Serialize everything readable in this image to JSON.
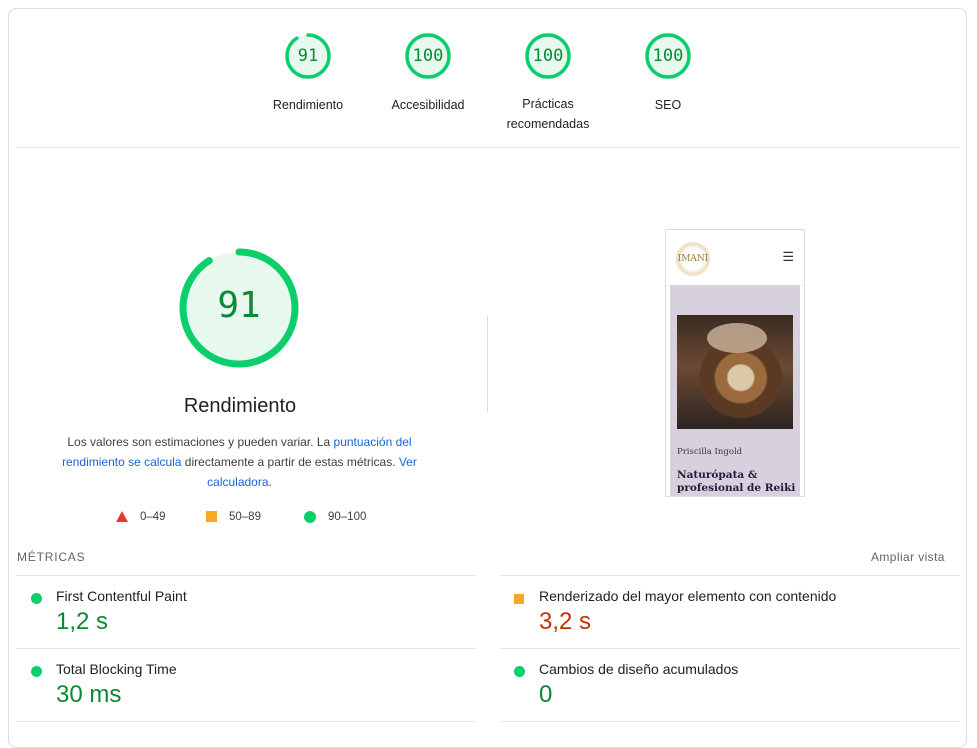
{
  "summary": {
    "scores": [
      {
        "value": "91",
        "label": "Rendimiento",
        "fraction": 0.91
      },
      {
        "value": "100",
        "label": "Accesibilidad",
        "fraction": 1.0
      },
      {
        "value": "100",
        "label": "Prácticas recomendadas",
        "fraction": 1.0
      },
      {
        "value": "100",
        "label": "SEO",
        "fraction": 1.0
      }
    ]
  },
  "performance": {
    "score": "91",
    "fraction": 0.91,
    "title": "Rendimiento",
    "desc_1": "Los valores son estimaciones y pueden variar. La ",
    "desc_link_1": "puntuación del rendimiento se calcula",
    "desc_2": " directamente a partir de estas métricas. ",
    "desc_link_2": "Ver calculadora",
    "desc_3": ".",
    "legend": [
      {
        "range": "0–49",
        "icon": "triangle-icon",
        "color": "#e53935"
      },
      {
        "range": "50–89",
        "icon": "square-icon",
        "color": "#f9a825"
      },
      {
        "range": "90–100",
        "icon": "circle-icon",
        "color": "#0cce6b"
      }
    ],
    "colors": {
      "good": "#0cce6b",
      "good_text": "#0a8a35",
      "good_fill": "#e7f8ee"
    }
  },
  "preview": {
    "logo_text": "IMANI",
    "menu_icon": "menu-icon",
    "name": "Priscilla Ingold",
    "role": "Naturópata & profesional de Reiki y"
  },
  "metrics": {
    "title": "MÉTRICAS",
    "expand_label": "Ampliar vista",
    "items": [
      {
        "name": "First Contentful Paint",
        "value": "1,2 s",
        "status": "good"
      },
      {
        "name": "Renderizado del mayor elemento con contenido",
        "value": "3,2 s",
        "status": "average"
      },
      {
        "name": "Total Blocking Time",
        "value": "30 ms",
        "status": "good"
      },
      {
        "name": "Cambios de diseño acumulados",
        "value": "0",
        "status": "good"
      }
    ]
  }
}
